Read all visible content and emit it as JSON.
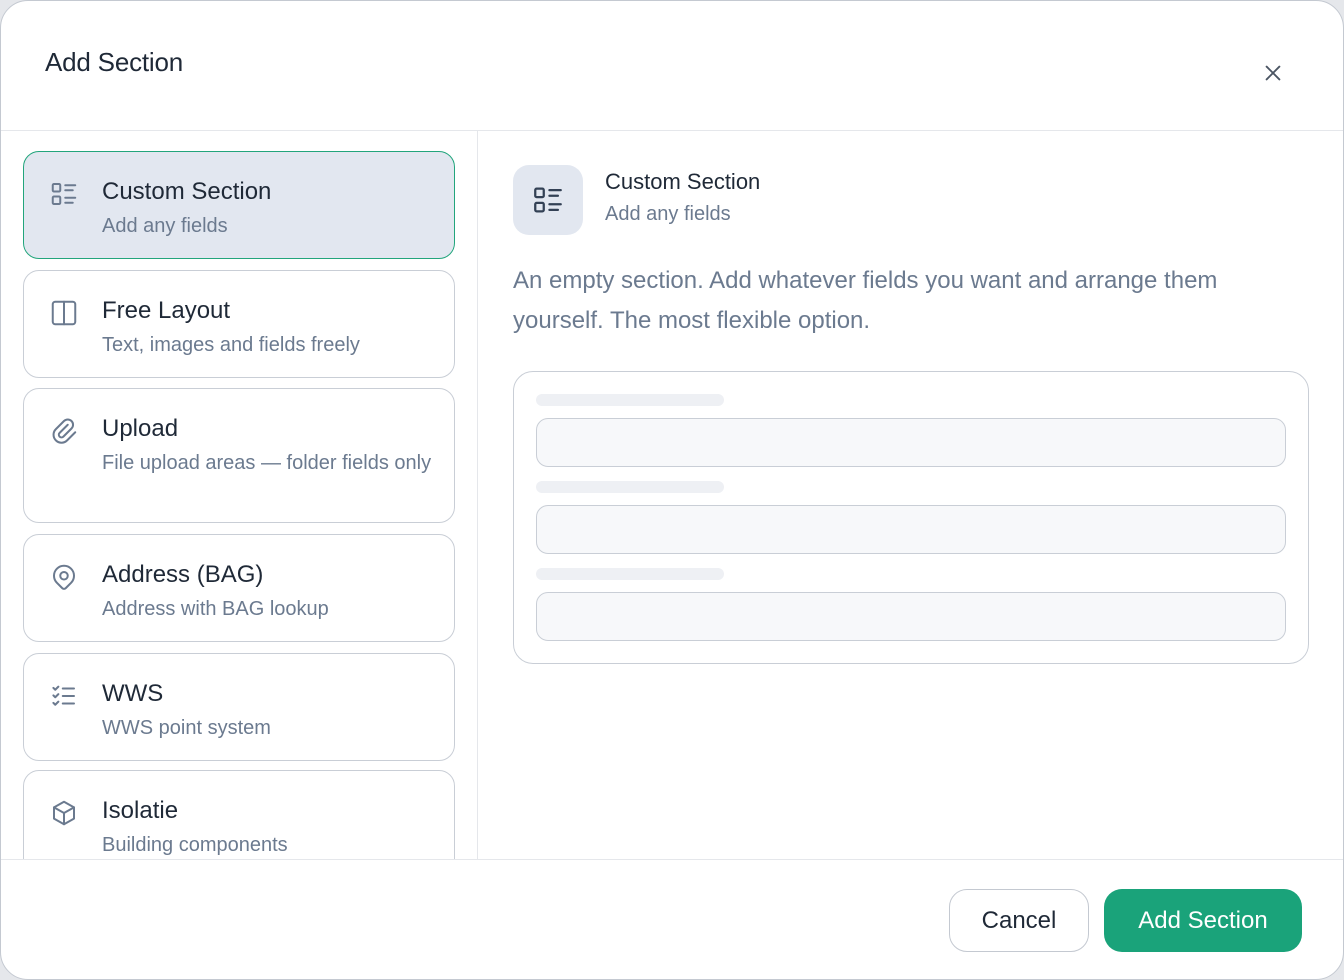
{
  "dialog": {
    "title": "Add Section",
    "close_icon": "close-icon"
  },
  "options": [
    {
      "icon": "list-details-icon",
      "title": "Custom Section",
      "subtitle": "Add any fields",
      "selected": true
    },
    {
      "icon": "columns-icon",
      "title": "Free Layout",
      "subtitle": "Text, images and fields freely",
      "selected": false
    },
    {
      "icon": "paperclip-icon",
      "title": "Upload",
      "subtitle": "File upload areas — folder fields only",
      "selected": false
    },
    {
      "icon": "map-pin-icon",
      "title": "Address (BAG)",
      "subtitle": "Address with BAG lookup",
      "selected": false
    },
    {
      "icon": "list-check-icon",
      "title": "WWS",
      "subtitle": "WWS point system",
      "selected": false
    },
    {
      "icon": "box-icon",
      "title": "Isolatie",
      "subtitle": "Building components",
      "selected": false
    }
  ],
  "preview": {
    "icon": "list-details-icon",
    "title": "Custom Section",
    "subtitle": "Add any fields",
    "description": "An empty section. Add whatever fields you want and arrange them yourself. The most flexible option."
  },
  "footer": {
    "cancel_label": "Cancel",
    "add_label": "Add Section"
  },
  "colors": {
    "accent": "#1aa37a",
    "selected_bg": "#e2e7f0",
    "selected_border": "#22a57c",
    "muted_text": "#6b7a8f"
  }
}
